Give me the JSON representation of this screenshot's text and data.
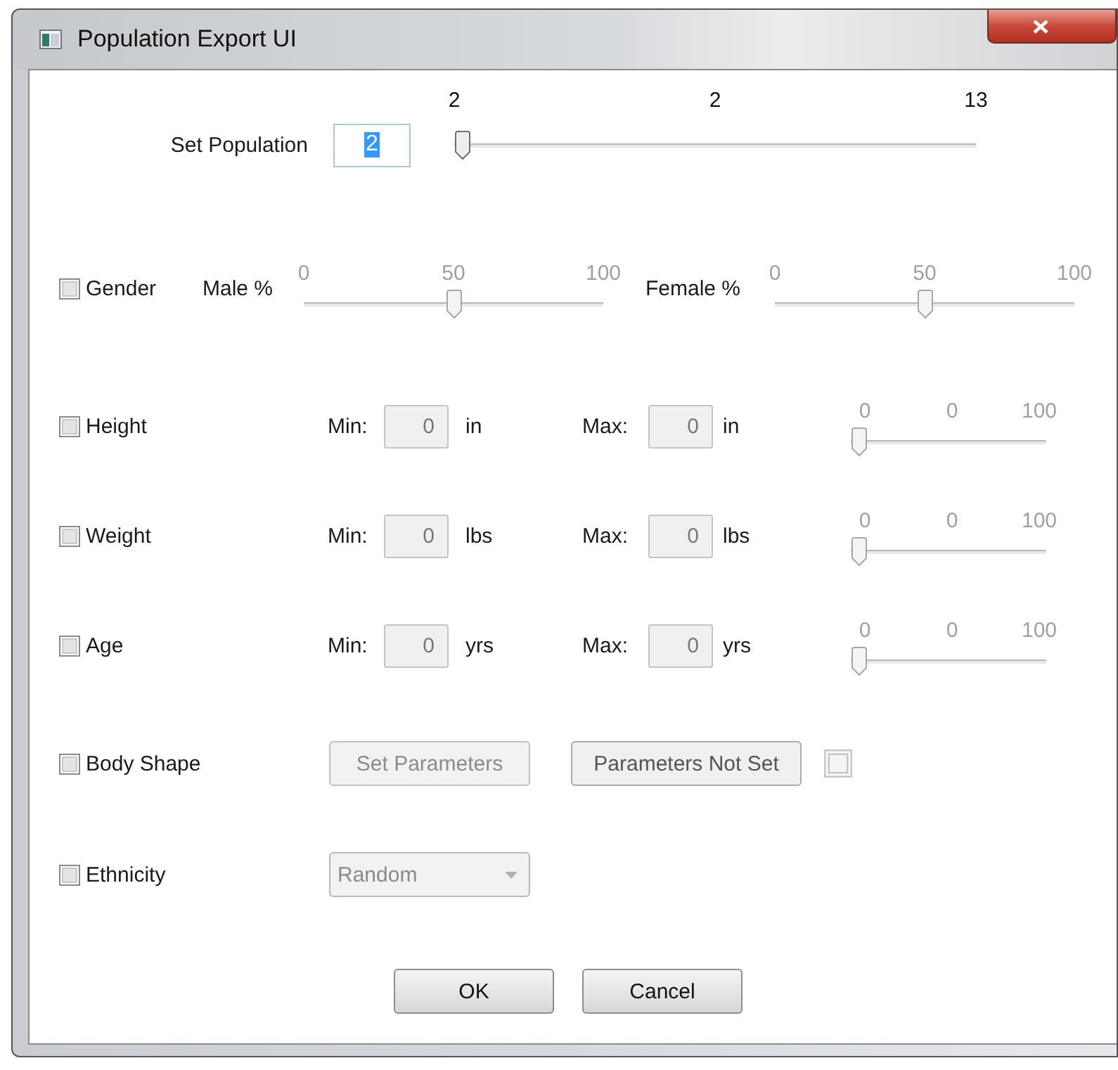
{
  "window": {
    "title": "Population Export UI"
  },
  "population": {
    "label": "Set Population",
    "value": "2",
    "value_selected": true,
    "slider": {
      "ticks": [
        "2",
        "2",
        "13"
      ],
      "level": 0,
      "disabled": false
    }
  },
  "gender": {
    "label": "Gender",
    "checked": false,
    "sliders": [
      {
        "label": "Male %",
        "ticks": [
          "0",
          "50",
          "100"
        ],
        "level": 0.5,
        "disabled": true
      },
      {
        "label": "Female %",
        "ticks": [
          "0",
          "50",
          "100"
        ],
        "level": 0.5,
        "disabled": true
      }
    ]
  },
  "measures": [
    {
      "label": "Height",
      "checked": false,
      "min_label": "Min:",
      "min_value": "0",
      "min_unit": "in",
      "max_label": "Max:",
      "max_value": "0",
      "max_unit": "in",
      "disabled": true,
      "slider": {
        "ticks": [
          "0",
          "0",
          "100"
        ],
        "level": 0,
        "disabled": true
      }
    },
    {
      "label": "Weight",
      "checked": false,
      "min_label": "Min:",
      "min_value": "0",
      "min_unit": "lbs",
      "max_label": "Max:",
      "max_value": "0",
      "max_unit": "lbs",
      "disabled": true,
      "slider": {
        "ticks": [
          "0",
          "0",
          "100"
        ],
        "level": 0,
        "disabled": true
      }
    },
    {
      "label": "Age",
      "checked": false,
      "min_label": "Min:",
      "min_value": "0",
      "min_unit": "yrs",
      "max_label": "Max:",
      "max_value": "0",
      "max_unit": "yrs",
      "disabled": true,
      "slider": {
        "ticks": [
          "0",
          "0",
          "100"
        ],
        "level": 0,
        "disabled": true
      }
    }
  ],
  "body_shape": {
    "label": "Body Shape",
    "checked": false,
    "set_button": {
      "label": "Set Parameters",
      "disabled": true
    },
    "status_button": {
      "label": "Parameters Not Set",
      "disabled": false
    },
    "status_checkbox": {
      "checked": false,
      "disabled": true
    }
  },
  "ethnicity": {
    "label": "Ethnicity",
    "checked": false,
    "combo": {
      "value": "Random",
      "disabled": true
    }
  },
  "buttons": [
    {
      "label": "OK"
    },
    {
      "label": "Cancel"
    }
  ]
}
